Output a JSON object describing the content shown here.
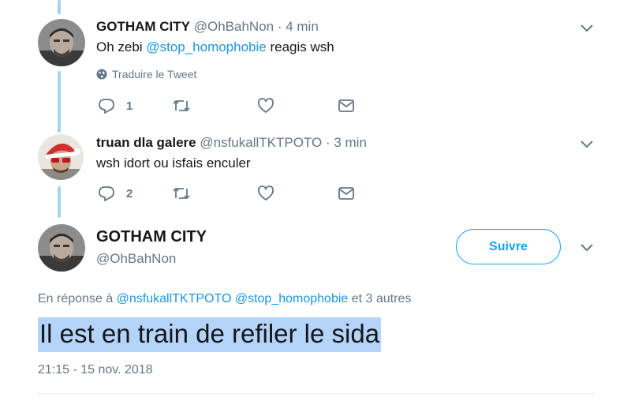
{
  "tweets": [
    {
      "name": "GOTHAM CITY",
      "handle": "@OhBahNon",
      "time": "4 min",
      "text_before": "Oh zebi ",
      "mention": "@stop_homophobie",
      "text_after": " reagis wsh",
      "translate": "Traduire le Tweet",
      "reply_count": "1"
    },
    {
      "name": "truan dla galere",
      "handle": "@nsfukallTKTPOTO",
      "time": "3 min",
      "text": "wsh idort ou isfais enculer",
      "reply_count": "2"
    }
  ],
  "main": {
    "name": "GOTHAM CITY",
    "handle": "@OhBahNon",
    "follow_label": "Suivre",
    "reply_prefix": "En réponse à ",
    "reply_mention_1": "@nsfukallTKTPOTO",
    "reply_mention_2": "@stop_homophobie",
    "reply_suffix": " et 3 autres",
    "text": "Il est en train de refiler le sida",
    "timestamp": "21:15 - 15 nov. 2018"
  },
  "separator": " · ",
  "icons": [
    "reply-icon",
    "retweet-icon",
    "like-icon",
    "direct-message-icon",
    "globe-icon",
    "chevron-down-icon"
  ],
  "colors": {
    "accent": "#1da1f2",
    "mention": "#1b95e0",
    "muted": "#657786",
    "thread_line": "#a3d5f3",
    "highlight": "#b5d4f9"
  }
}
